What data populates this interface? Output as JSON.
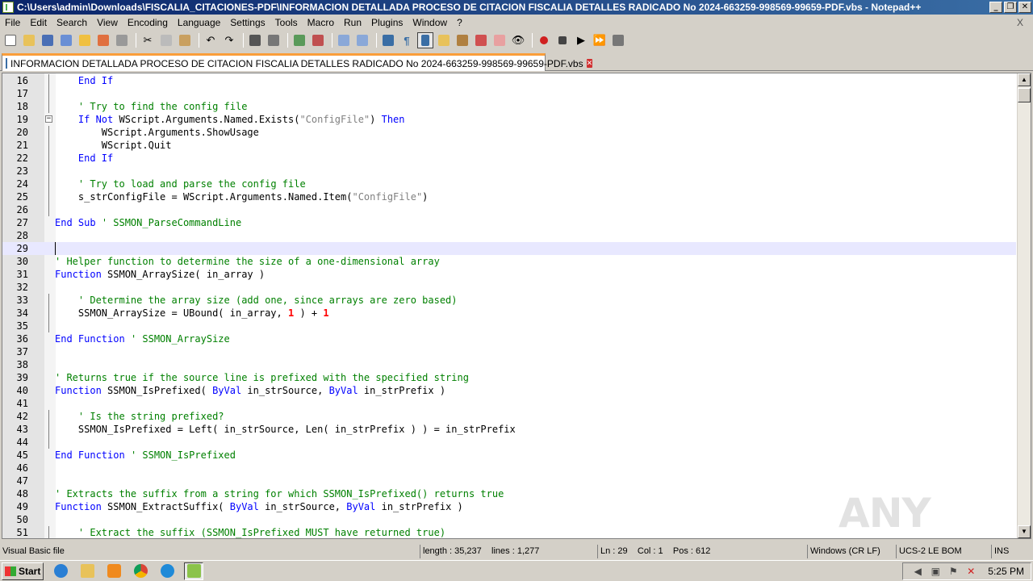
{
  "window": {
    "title": "C:\\Users\\admin\\Downloads\\FISCALIA_CITACIONES-PDF\\INFORMACION DETALLADA PROCESO DE CITACION FISCALIA DETALLES RADICADO No 2024-663259-998569-99659-PDF.vbs - Notepad++",
    "minimize": "_",
    "restore": "❐",
    "close": "✕"
  },
  "menu": {
    "items": [
      "File",
      "Edit",
      "Search",
      "View",
      "Encoding",
      "Language",
      "Settings",
      "Tools",
      "Macro",
      "Run",
      "Plugins",
      "Window",
      "?"
    ],
    "close_doc": "X"
  },
  "tab": {
    "label": "INFORMACION DETALLADA PROCESO DE CITACION FISCALIA DETALLES RADICADO No 2024-663259-998569-99659-PDF.vbs",
    "close": "✕"
  },
  "editor": {
    "current_line": "29",
    "lines": [
      {
        "n": "16",
        "indent": "    ",
        "html": "<span class='kw'>End If</span>"
      },
      {
        "n": "17",
        "indent": "",
        "html": ""
      },
      {
        "n": "18",
        "indent": "    ",
        "html": "<span class='cm'>' Try to find the config file</span>"
      },
      {
        "n": "19",
        "indent": "    ",
        "html": "<span class='kw'>If Not</span> WScript.Arguments.Named.Exists(<span class='st'>\"ConfigFile\"</span>) <span class='kw'>Then</span>"
      },
      {
        "n": "20",
        "indent": "        ",
        "html": "WScript.Arguments.ShowUsage"
      },
      {
        "n": "21",
        "indent": "        ",
        "html": "WScript.Quit"
      },
      {
        "n": "22",
        "indent": "    ",
        "html": "<span class='kw'>End If</span>"
      },
      {
        "n": "23",
        "indent": "",
        "html": ""
      },
      {
        "n": "24",
        "indent": "    ",
        "html": "<span class='cm'>' Try to load and parse the config file</span>"
      },
      {
        "n": "25",
        "indent": "    ",
        "html": "s_strConfigFile = WScript.Arguments.Named.Item(<span class='st'>\"ConfigFile\"</span>)"
      },
      {
        "n": "26",
        "indent": "",
        "html": ""
      },
      {
        "n": "27",
        "indent": "",
        "html": "<span class='kw'>End Sub</span> <span class='cm'>' SSMON_ParseCommandLine</span>"
      },
      {
        "n": "28",
        "indent": "",
        "html": ""
      },
      {
        "n": "29",
        "indent": "",
        "html": ""
      },
      {
        "n": "30",
        "indent": "",
        "html": "<span class='cm'>' Helper function to determine the size of a one-dimensional array</span>"
      },
      {
        "n": "31",
        "indent": "",
        "html": "<span class='kw'>Function</span> SSMON_ArraySize( in_array )"
      },
      {
        "n": "32",
        "indent": "",
        "html": ""
      },
      {
        "n": "33",
        "indent": "    ",
        "html": "<span class='cm'>' Determine the array size (add one, since arrays are zero based)</span>"
      },
      {
        "n": "34",
        "indent": "    ",
        "html": "SSMON_ArraySize = UBound( in_array, <span class='nm'>1</span> ) + <span class='nm'>1</span>"
      },
      {
        "n": "35",
        "indent": "",
        "html": ""
      },
      {
        "n": "36",
        "indent": "",
        "html": "<span class='kw'>End Function</span> <span class='cm'>' SSMON_ArraySize</span>"
      },
      {
        "n": "37",
        "indent": "",
        "html": ""
      },
      {
        "n": "38",
        "indent": "",
        "html": ""
      },
      {
        "n": "39",
        "indent": "",
        "html": "<span class='cm'>' Returns true if the source line is prefixed with the specified string</span>"
      },
      {
        "n": "40",
        "indent": "",
        "html": "<span class='kw'>Function</span> SSMON_IsPrefixed( <span class='kw'>ByVal</span> in_strSource, <span class='kw'>ByVal</span> in_strPrefix )"
      },
      {
        "n": "41",
        "indent": "",
        "html": ""
      },
      {
        "n": "42",
        "indent": "    ",
        "html": "<span class='cm'>' Is the string prefixed?</span>"
      },
      {
        "n": "43",
        "indent": "    ",
        "html": "SSMON_IsPrefixed = Left( in_strSource, Len( in_strPrefix ) ) = in_strPrefix"
      },
      {
        "n": "44",
        "indent": "",
        "html": ""
      },
      {
        "n": "45",
        "indent": "",
        "html": "<span class='kw'>End Function</span> <span class='cm'>' SSMON_IsPrefixed</span>"
      },
      {
        "n": "46",
        "indent": "",
        "html": ""
      },
      {
        "n": "47",
        "indent": "",
        "html": ""
      },
      {
        "n": "48",
        "indent": "",
        "html": "<span class='cm'>' Extracts the suffix from a string for which SSMON_IsPrefixed() returns true</span>"
      },
      {
        "n": "49",
        "indent": "",
        "html": "<span class='kw'>Function</span> SSMON_ExtractSuffix( <span class='kw'>ByVal</span> in_strSource, <span class='kw'>ByVal</span> in_strPrefix )"
      },
      {
        "n": "50",
        "indent": "",
        "html": ""
      },
      {
        "n": "51",
        "indent": "    ",
        "html": "<span class='cm'>' Extract the suffix (SSMON_IsPrefixed MUST have returned true)</span>"
      }
    ]
  },
  "watermark": "ANY RUN",
  "status": {
    "language": "Visual Basic file",
    "length": "length : 35,237",
    "lines": "lines : 1,277",
    "ln": "Ln : 29",
    "col": "Col : 1",
    "pos": "Pos : 612",
    "eol": "Windows (CR LF)",
    "encoding": "UCS-2 LE BOM",
    "mode": "INS"
  },
  "taskbar": {
    "start": "Start",
    "clock": "5:25 PM",
    "colors": {
      "ie": "#2a7fd4",
      "explorer": "#e8c25a",
      "media": "#f08a1e",
      "chrome": "#db4437",
      "edge": "#1f8ad8",
      "notepadpp": "#8bc34a"
    }
  }
}
